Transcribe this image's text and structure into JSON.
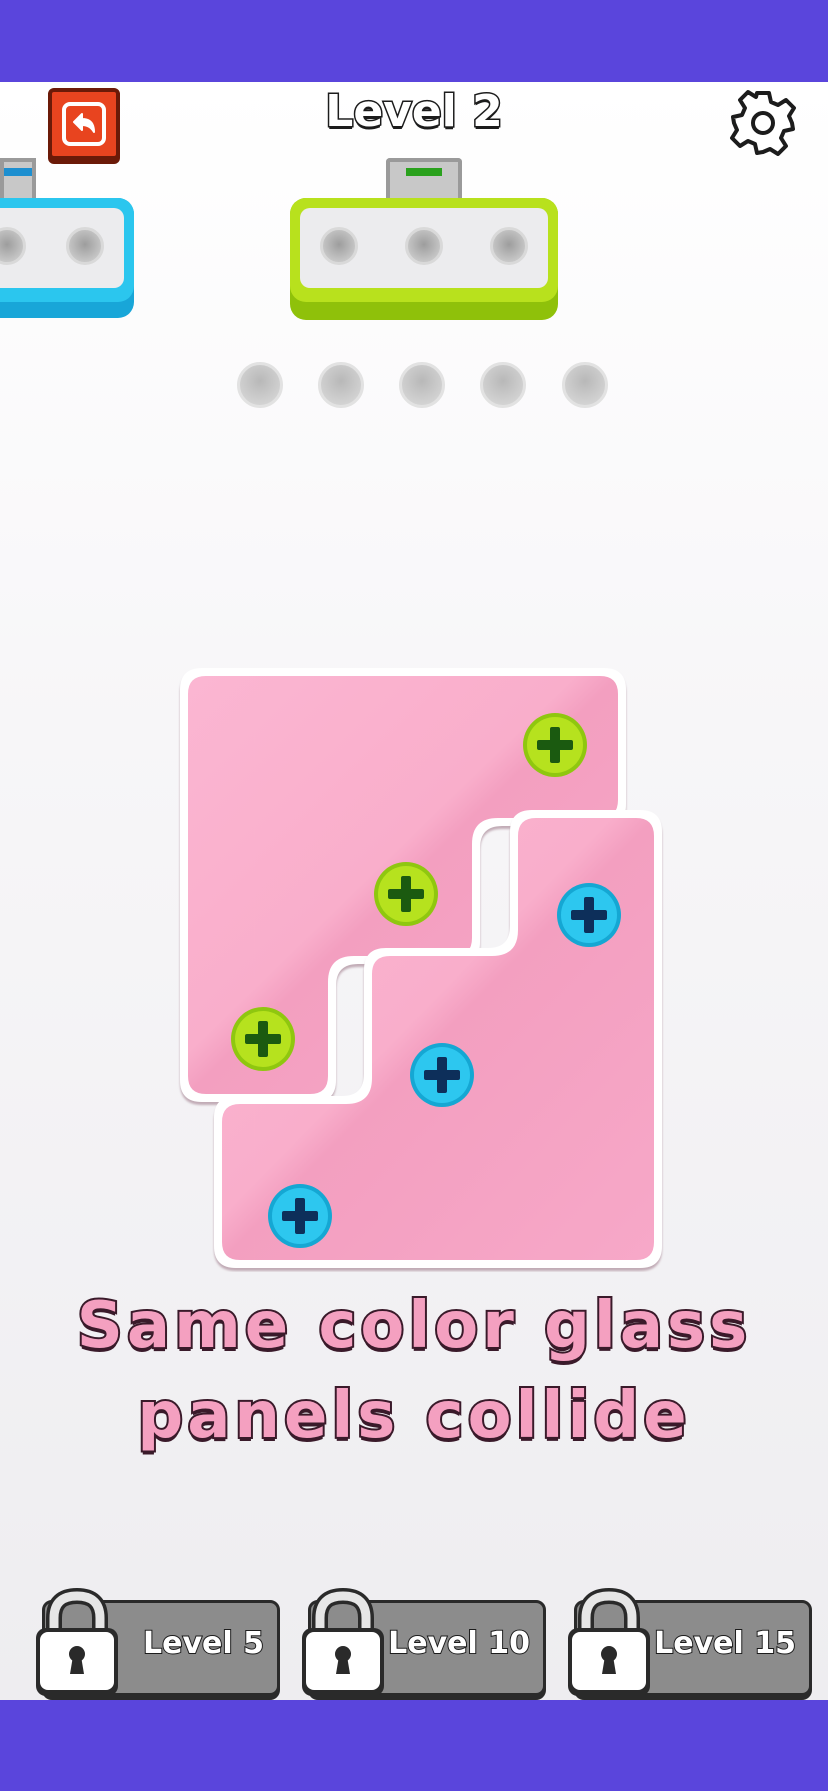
{
  "header": {
    "title": "Level 2",
    "back_icon": "back-arrow-icon",
    "settings_icon": "gear-icon"
  },
  "boxes": [
    {
      "color": "#2bc4ec",
      "shade": "#17a6d6",
      "holes": 3
    },
    {
      "color": "#b7e01c",
      "shade": "#8dbe0a",
      "holes": 3
    }
  ],
  "slots": {
    "count": 5
  },
  "board": {
    "panel_color": "#f7aac9",
    "screws": [
      {
        "color": "green"
      },
      {
        "color": "green"
      },
      {
        "color": "green"
      },
      {
        "color": "blue"
      },
      {
        "color": "blue"
      },
      {
        "color": "blue"
      }
    ]
  },
  "hint": {
    "line1": "Same color glass",
    "line2": "panels collide"
  },
  "locked_levels": [
    {
      "label": "Level 5"
    },
    {
      "label": "Level 10"
    },
    {
      "label": "Level 15"
    }
  ],
  "colors": {
    "accent": "#e8441f",
    "background_band": "#5a45dc"
  }
}
